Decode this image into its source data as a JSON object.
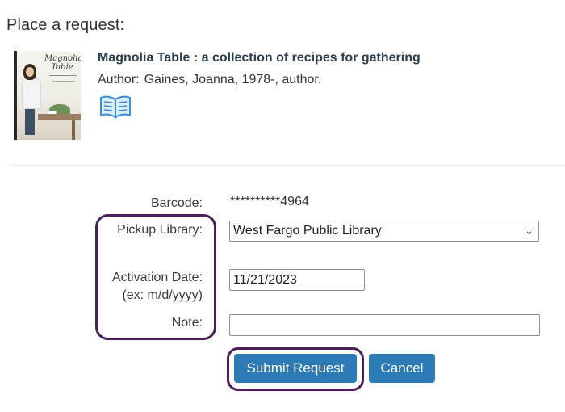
{
  "page": {
    "title": "Place a request:"
  },
  "book": {
    "cover_title": "Magnolia Table",
    "title": "Magnolia Table : a collection of recipes for gathering",
    "author_label": "Author:",
    "author": "Gaines, Joanna, 1978-, author.",
    "format_icon": "open-book-icon"
  },
  "form": {
    "barcode_label": "Barcode:",
    "barcode_value": "**********4964",
    "pickup_label": "Pickup Library:",
    "pickup_selected": "West Fargo Public Library",
    "activation_label": "Activation Date:",
    "activation_hint": "(ex: m/d/yyyy)",
    "activation_value": "11/21/2023",
    "note_label": "Note:",
    "note_value": ""
  },
  "buttons": {
    "submit": "Submit Request",
    "cancel": "Cancel"
  },
  "colors": {
    "button": "#2c7bb6",
    "highlight": "#4b1d5a",
    "book_icon": "#3a8fd6",
    "title": "#2c3e50"
  }
}
